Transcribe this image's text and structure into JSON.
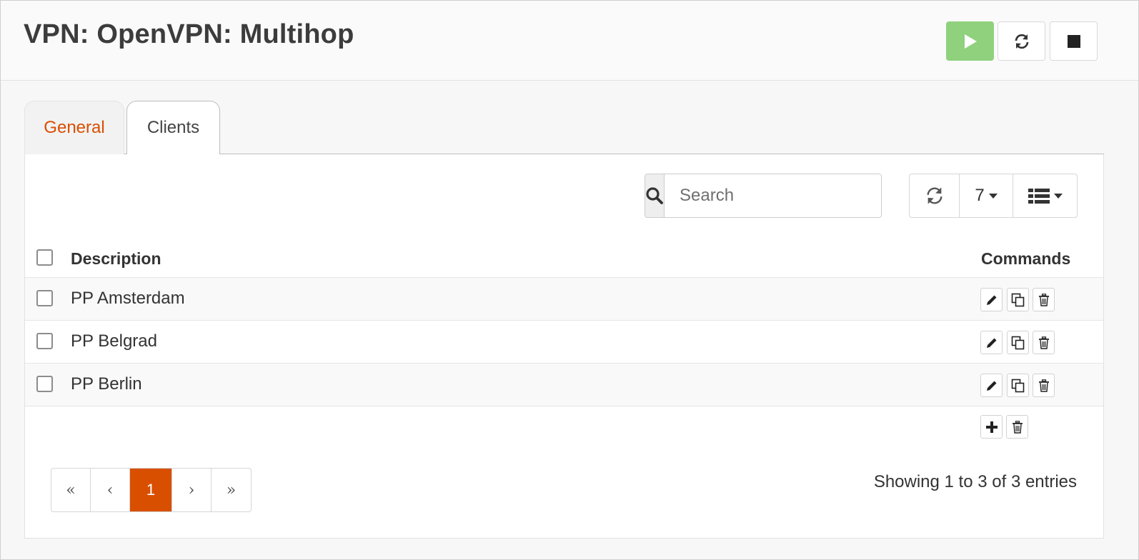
{
  "header": {
    "title": "VPN: OpenVPN: Multihop",
    "buttons": {
      "start": "play-icon",
      "restart": "refresh-icon",
      "stop": "stop-icon"
    }
  },
  "tabs": [
    {
      "label": "General",
      "active": false
    },
    {
      "label": "Clients",
      "active": true
    }
  ],
  "toolbar": {
    "search_placeholder": "Search",
    "page_size": "7"
  },
  "table": {
    "columns": {
      "description": "Description",
      "commands": "Commands"
    },
    "rows": [
      {
        "description": "PP Amsterdam"
      },
      {
        "description": "PP Belgrad"
      },
      {
        "description": "PP Berlin"
      }
    ]
  },
  "pagination": {
    "first": "«",
    "prev": "‹",
    "current": "1",
    "next": "›",
    "last": "»"
  },
  "footer": {
    "info": "Showing 1 to 3 of 3 entries"
  },
  "colors": {
    "accent": "#d94f00",
    "start_green": "#8fd17d"
  }
}
